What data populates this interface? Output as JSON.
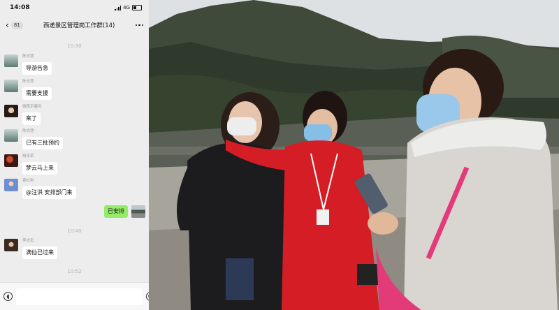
{
  "status_bar": {
    "time": "14:08",
    "network": "4G"
  },
  "chat_header": {
    "back_count": "81",
    "title": "西递景区管理岗工作群(14)"
  },
  "timestamps": [
    "10:30",
    "10:40",
    "10:52"
  ],
  "messages": [
    {
      "sender": "陈志慧",
      "text": "导游告急"
    },
    {
      "sender": "陈志慧",
      "text": "需要支援"
    },
    {
      "sender": "微黄京春风",
      "text": "来了"
    },
    {
      "sender": "陈志慧",
      "text": "已有三批预约"
    },
    {
      "sender": "胡永荣",
      "text": "梦云马上来"
    },
    {
      "sender": "章社利",
      "text": "@汪洪 安排部门来"
    },
    {
      "sender": "",
      "text": "已安排"
    },
    {
      "sender": "李志忠",
      "text": "满仙已过来"
    }
  ],
  "input_bar": {
    "voice_icon": "voice-icon",
    "emoji_icon": "emoji-icon",
    "add_icon": "plus-icon"
  },
  "photo": {
    "description_icons": [
      "photo"
    ]
  }
}
